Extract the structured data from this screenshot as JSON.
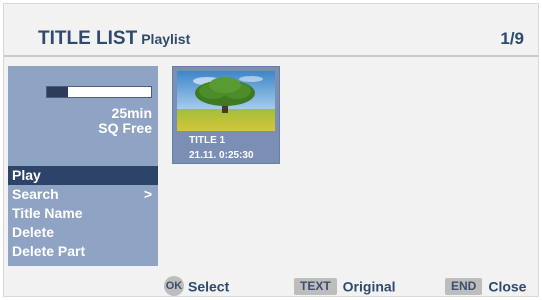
{
  "header": {
    "title": "TITLE LIST",
    "subtitle": "Playlist",
    "page_indicator": "1/9"
  },
  "sidebar": {
    "progress_fraction": 0.2,
    "capacity_time": "25min",
    "capacity_mode": "SQ",
    "capacity_label": "Free",
    "menu": [
      {
        "label": "Play",
        "selected": true
      },
      {
        "label": "Search",
        "arrow": ">"
      },
      {
        "label": "Title Name"
      },
      {
        "label": "Delete"
      },
      {
        "label": "Delete Part"
      }
    ]
  },
  "titles": [
    {
      "name": "TITLE 1",
      "date": "21.11.",
      "duration": "0:25:30"
    }
  ],
  "footer": {
    "ok_key": "OK",
    "ok_label": "Select",
    "text_key": "TEXT",
    "text_label": "Original",
    "end_key": "END",
    "end_label": "Close"
  },
  "colors": {
    "panel_bg": "#f2f2f2",
    "title_text": "#2f4a6e",
    "sidebar_bg": "#8fa4c5",
    "selected_item": "#2d4468"
  }
}
